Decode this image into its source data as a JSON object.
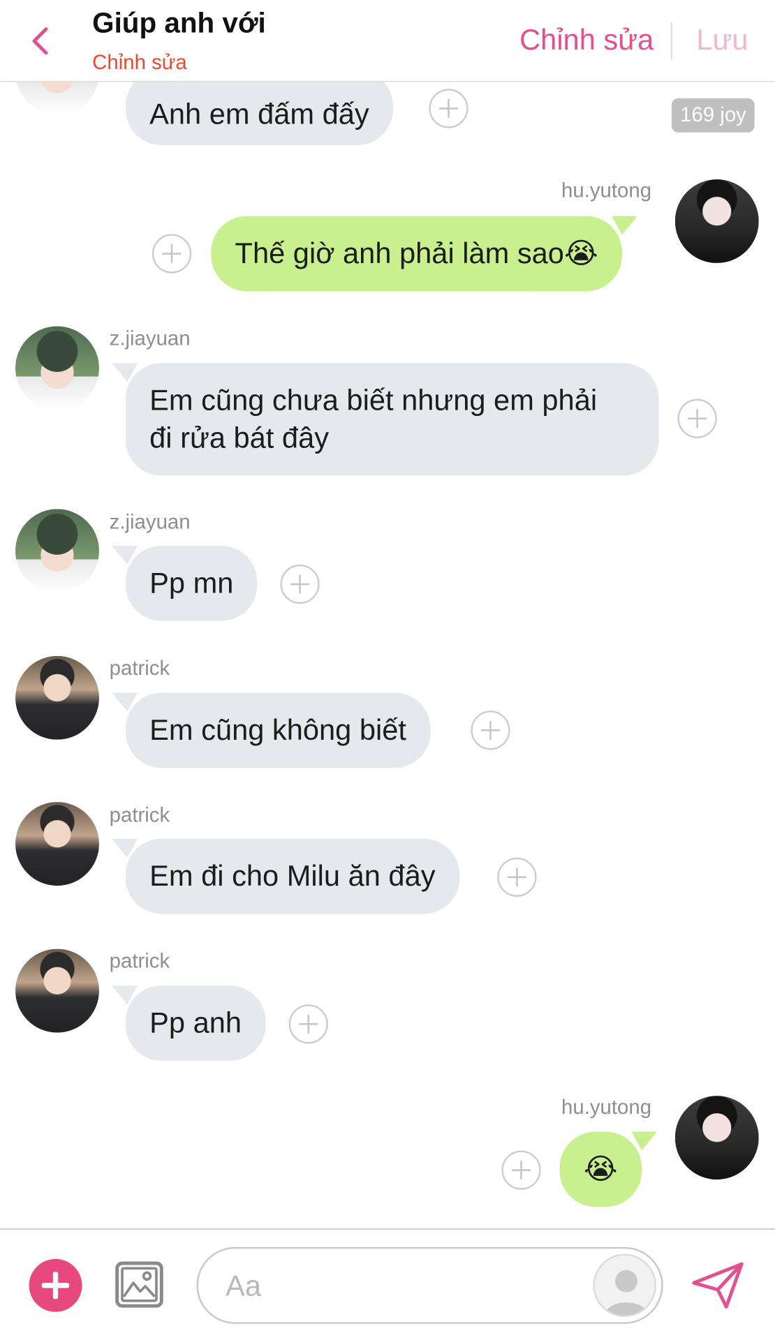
{
  "header": {
    "title": "Giúp anh với",
    "subtitle": "Chỉnh sửa",
    "edit_label": "Chỉnh sửa",
    "save_label": "Lưu"
  },
  "badge": {
    "joy": "169 joy"
  },
  "messages": [
    {
      "sender": "",
      "text": "Anh em đấm đấy",
      "side": "in"
    },
    {
      "sender": "hu.yutong",
      "text": "Thế giờ anh phải làm sao😭",
      "side": "out"
    },
    {
      "sender": "z.jiayuan",
      "text_line1": "Em cũng chưa biết nhưng em phải",
      "text_line2": "đi rửa bát đây",
      "side": "in"
    },
    {
      "sender": "z.jiayuan",
      "text": "Pp mn",
      "side": "in"
    },
    {
      "sender": "patrick",
      "text": "Em cũng không biết",
      "side": "in"
    },
    {
      "sender": "patrick",
      "text": "Em đi cho Milu ăn đây",
      "side": "in"
    },
    {
      "sender": "patrick",
      "text": "Pp anh",
      "side": "in"
    },
    {
      "sender": "hu.yutong",
      "text": "😭",
      "side": "out"
    }
  ],
  "composer": {
    "placeholder": "Aa"
  },
  "colors": {
    "accent": "#e4508f",
    "subtitle": "#e8492f",
    "incoming_bubble": "#e5e8ec",
    "outgoing_bubble": "#c9f08e"
  }
}
